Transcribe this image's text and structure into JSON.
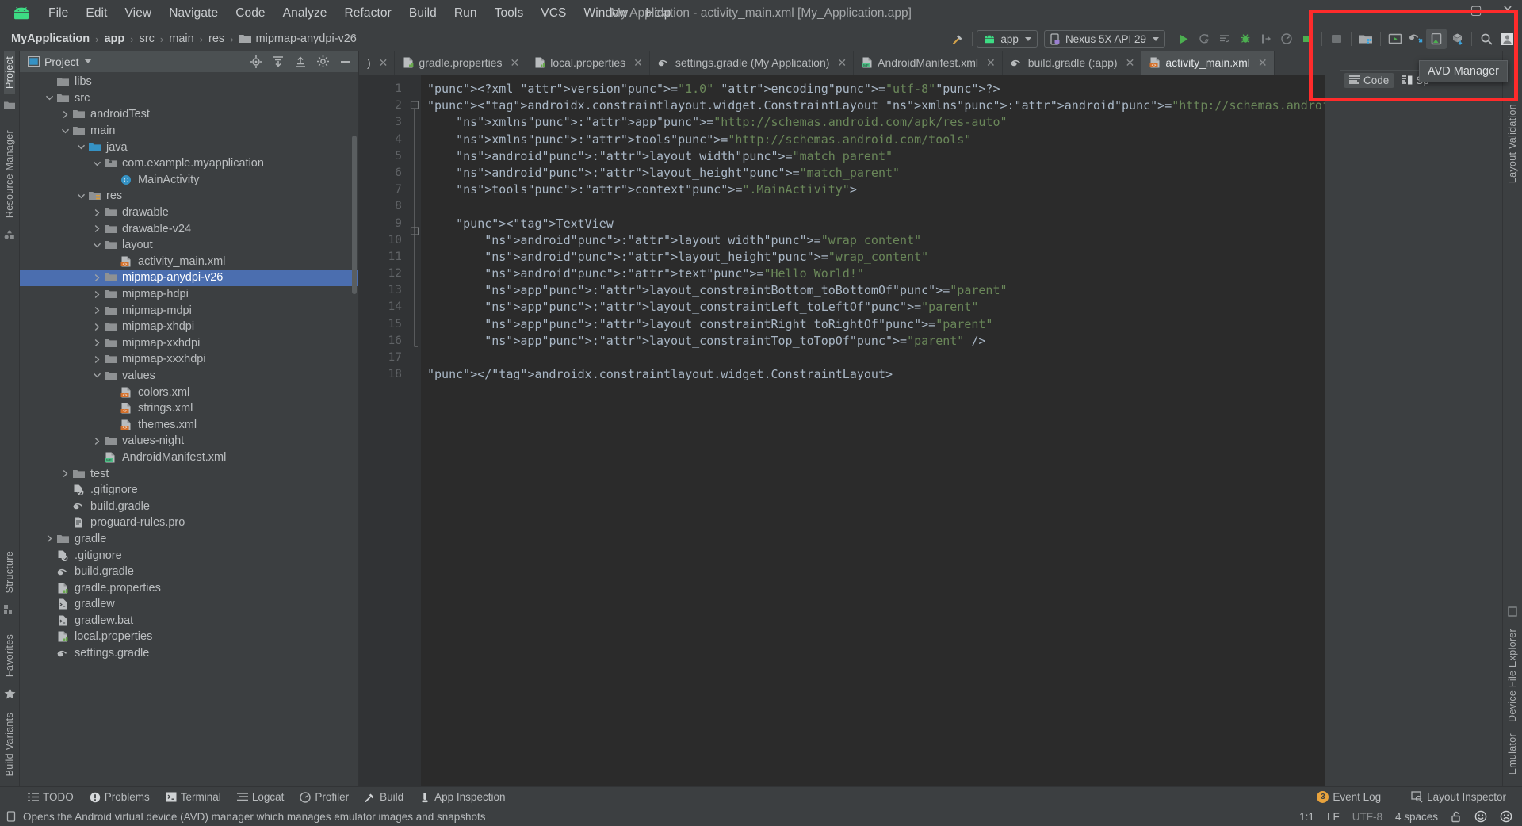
{
  "window": {
    "title": "My Application - activity_main.xml [My_Application.app]",
    "minimize": "–",
    "maximize": "▢",
    "close": "✕"
  },
  "menubar": {
    "logo_icon": "android-robot-icon",
    "items": [
      {
        "label": "File"
      },
      {
        "label": "Edit"
      },
      {
        "label": "View"
      },
      {
        "label": "Navigate"
      },
      {
        "label": "Code"
      },
      {
        "label": "Analyze"
      },
      {
        "label": "Refactor"
      },
      {
        "label": "Build"
      },
      {
        "label": "Run"
      },
      {
        "label": "Tools"
      },
      {
        "label": "VCS"
      },
      {
        "label": "Window"
      },
      {
        "label": "Help"
      }
    ]
  },
  "breadcrumb": {
    "segments": [
      "MyApplication",
      "app",
      "src",
      "main",
      "res",
      "mipmap-anydpi-v26"
    ],
    "separator": "›"
  },
  "toolbar": {
    "build_hammer_icon": "hammer-icon",
    "module_selector": "app",
    "device_selector": "Nexus 5X API 29",
    "run_icon": "run-play-icon",
    "apply_changes_icon": "apply-changes-icon",
    "apply_code_changes_icon": "apply-code-changes-icon",
    "debug_icon": "debug-bug-icon",
    "attach_debugger_icon": "attach-debugger-icon",
    "profile_icon": "profiler-icon",
    "stop_icon": "stop-icon",
    "sdk_manager_icon": "sdk-manager-icon",
    "layout_inspector_icon": "layout-inspector-icon",
    "device_file_icon": "device-file-explorer-icon",
    "avd_manager_icon": "avd-manager-icon",
    "sync_gradle_icon": "sync-gradle-icon",
    "search_icon": "search-icon",
    "avatar_icon": "user-avatar-icon"
  },
  "tooltip": {
    "text": "AVD Manager"
  },
  "project_panel": {
    "title": "Project",
    "dropdown_icon": "chevron-down-icon",
    "locate_icon": "locate-target-icon",
    "expand_icon": "expand-all-icon",
    "collapse_icon": "collapse-all-icon",
    "settings_icon": "gear-icon",
    "hide_icon": "minimize-icon",
    "tree": [
      {
        "label": "libs",
        "depth": 2,
        "arrow": "none",
        "icon": "folder",
        "sel": false
      },
      {
        "label": "src",
        "depth": 2,
        "arrow": "open",
        "icon": "folder",
        "sel": false
      },
      {
        "label": "androidTest",
        "depth": 3,
        "arrow": "closed",
        "icon": "folder",
        "sel": false
      },
      {
        "label": "main",
        "depth": 3,
        "arrow": "open",
        "icon": "folder",
        "sel": false
      },
      {
        "label": "java",
        "depth": 4,
        "arrow": "open",
        "icon": "folder-blue",
        "sel": false
      },
      {
        "label": "com.example.myapplication",
        "depth": 5,
        "arrow": "open",
        "icon": "package",
        "sel": false
      },
      {
        "label": "MainActivity",
        "depth": 6,
        "arrow": "none",
        "icon": "class",
        "sel": false
      },
      {
        "label": "res",
        "depth": 4,
        "arrow": "open",
        "icon": "folder-res",
        "sel": false
      },
      {
        "label": "drawable",
        "depth": 5,
        "arrow": "closed",
        "icon": "folder",
        "sel": false
      },
      {
        "label": "drawable-v24",
        "depth": 5,
        "arrow": "closed",
        "icon": "folder",
        "sel": false
      },
      {
        "label": "layout",
        "depth": 5,
        "arrow": "open",
        "icon": "folder",
        "sel": false
      },
      {
        "label": "activity_main.xml",
        "depth": 6,
        "arrow": "none",
        "icon": "xml",
        "sel": false
      },
      {
        "label": "mipmap-anydpi-v26",
        "depth": 5,
        "arrow": "closed",
        "icon": "folder",
        "sel": true
      },
      {
        "label": "mipmap-hdpi",
        "depth": 5,
        "arrow": "closed",
        "icon": "folder",
        "sel": false
      },
      {
        "label": "mipmap-mdpi",
        "depth": 5,
        "arrow": "closed",
        "icon": "folder",
        "sel": false
      },
      {
        "label": "mipmap-xhdpi",
        "depth": 5,
        "arrow": "closed",
        "icon": "folder",
        "sel": false
      },
      {
        "label": "mipmap-xxhdpi",
        "depth": 5,
        "arrow": "closed",
        "icon": "folder",
        "sel": false
      },
      {
        "label": "mipmap-xxxhdpi",
        "depth": 5,
        "arrow": "closed",
        "icon": "folder",
        "sel": false
      },
      {
        "label": "values",
        "depth": 5,
        "arrow": "open",
        "icon": "folder",
        "sel": false
      },
      {
        "label": "colors.xml",
        "depth": 6,
        "arrow": "none",
        "icon": "xml",
        "sel": false
      },
      {
        "label": "strings.xml",
        "depth": 6,
        "arrow": "none",
        "icon": "xml",
        "sel": false
      },
      {
        "label": "themes.xml",
        "depth": 6,
        "arrow": "none",
        "icon": "xml",
        "sel": false
      },
      {
        "label": "values-night",
        "depth": 5,
        "arrow": "closed",
        "icon": "folder",
        "sel": false
      },
      {
        "label": "AndroidManifest.xml",
        "depth": 5,
        "arrow": "none",
        "icon": "manifest",
        "sel": false
      },
      {
        "label": "test",
        "depth": 3,
        "arrow": "closed",
        "icon": "folder",
        "sel": false
      },
      {
        "label": ".gitignore",
        "depth": 3,
        "arrow": "none",
        "icon": "gitignore",
        "sel": false
      },
      {
        "label": "build.gradle",
        "depth": 3,
        "arrow": "none",
        "icon": "gradle",
        "sel": false
      },
      {
        "label": "proguard-rules.pro",
        "depth": 3,
        "arrow": "none",
        "icon": "textfile",
        "sel": false
      },
      {
        "label": "gradle",
        "depth": 2,
        "arrow": "closed",
        "icon": "folder",
        "sel": false
      },
      {
        "label": ".gitignore",
        "depth": 2,
        "arrow": "none",
        "icon": "gitignore",
        "sel": false
      },
      {
        "label": "build.gradle",
        "depth": 2,
        "arrow": "none",
        "icon": "gradle",
        "sel": false
      },
      {
        "label": "gradle.properties",
        "depth": 2,
        "arrow": "none",
        "icon": "properties",
        "sel": false
      },
      {
        "label": "gradlew",
        "depth": 2,
        "arrow": "none",
        "icon": "script",
        "sel": false
      },
      {
        "label": "gradlew.bat",
        "depth": 2,
        "arrow": "none",
        "icon": "script",
        "sel": false
      },
      {
        "label": "local.properties",
        "depth": 2,
        "arrow": "none",
        "icon": "properties",
        "sel": false
      },
      {
        "label": "settings.gradle",
        "depth": 2,
        "arrow": "none",
        "icon": "gradle",
        "sel": false
      }
    ]
  },
  "left_strip": {
    "project_tab": "Project",
    "resource_manager_tab": "Resource Manager",
    "structure_tab": "Structure",
    "favorites_tab": "Favorites",
    "build_variants_tab": "Build Variants"
  },
  "right_strip": {
    "layout_validation_tab": "Layout Validation",
    "device_file_explorer_tab": "Device File Explorer",
    "emulator_tab": "Emulator"
  },
  "editor_tabs": [
    {
      "label": ")",
      "icon": "xml",
      "active": false
    },
    {
      "label": "gradle.properties",
      "icon": "properties",
      "active": false
    },
    {
      "label": "local.properties",
      "icon": "properties",
      "active": false
    },
    {
      "label": "settings.gradle (My Application)",
      "icon": "gradle",
      "active": false
    },
    {
      "label": "AndroidManifest.xml",
      "icon": "manifest",
      "active": false
    },
    {
      "label": "build.gradle (:app)",
      "icon": "gradle",
      "active": false
    },
    {
      "label": "activity_main.xml",
      "icon": "xml",
      "active": true
    }
  ],
  "design_bar": {
    "code_label": "Code",
    "split_label": "Sp",
    "code_icon": "code-view-icon",
    "split_icon": "split-view-icon"
  },
  "code": {
    "filename": "activity_main.xml",
    "line_numbers": [
      1,
      2,
      3,
      4,
      5,
      6,
      7,
      8,
      9,
      10,
      11,
      12,
      13,
      14,
      15,
      16,
      17,
      18
    ],
    "lines": [
      "<?xml version=\"1.0\" encoding=\"utf-8\"?>",
      "<androidx.constraintlayout.widget.ConstraintLayout xmlns:android=\"http://schemas.android.com/apk/res/android\"",
      "    xmlns:app=\"http://schemas.android.com/apk/res-auto\"",
      "    xmlns:tools=\"http://schemas.android.com/tools\"",
      "    android:layout_width=\"match_parent\"",
      "    android:layout_height=\"match_parent\"",
      "    tools:context=\".MainActivity\">",
      "",
      "    <TextView",
      "        android:layout_width=\"wrap_content\"",
      "        android:layout_height=\"wrap_content\"",
      "        android:text=\"Hello World!\"",
      "        app:layout_constraintBottom_toBottomOf=\"parent\"",
      "        app:layout_constraintLeft_toLeftOf=\"parent\"",
      "        app:layout_constraintRight_toRightOf=\"parent\"",
      "        app:layout_constraintTop_toTopOf=\"parent\" />",
      "",
      "</androidx.constraintlayout.widget.ConstraintLayout>"
    ]
  },
  "bottom_bar": {
    "items": [
      {
        "label": "TODO",
        "icon": "todo-icon"
      },
      {
        "label": "Problems",
        "icon": "problems-icon"
      },
      {
        "label": "Terminal",
        "icon": "terminal-icon"
      },
      {
        "label": "Logcat",
        "icon": "logcat-icon"
      },
      {
        "label": "Profiler",
        "icon": "profiler-icon"
      },
      {
        "label": "Build",
        "icon": "build-hammer-icon"
      },
      {
        "label": "App Inspection",
        "icon": "app-inspection-icon"
      }
    ],
    "event_log": "Event Log",
    "event_log_count": "3",
    "layout_inspector": "Layout Inspector",
    "layout_inspector_icon": "layout-inspector-icon"
  },
  "status_bar": {
    "message": "Opens the Android virtual device (AVD) manager which manages emulator images and snapshots",
    "message_icon": "device-icon",
    "caret_position": "1:1",
    "line_separator": "LF",
    "encoding": "UTF-8",
    "indent": "4 spaces",
    "lock_icon": "unlocked-icon",
    "happy_icon": "happy-face-icon",
    "sad_icon": "sad-face-icon"
  },
  "colors": {
    "accent_selection": "#4b6eaf",
    "annotation_red": "#ff2b2b",
    "panel_bg": "#3c3f41",
    "editor_bg": "#2b2b2b",
    "android_green": "#3ddc84",
    "badge_orange": "#e8a33d"
  }
}
